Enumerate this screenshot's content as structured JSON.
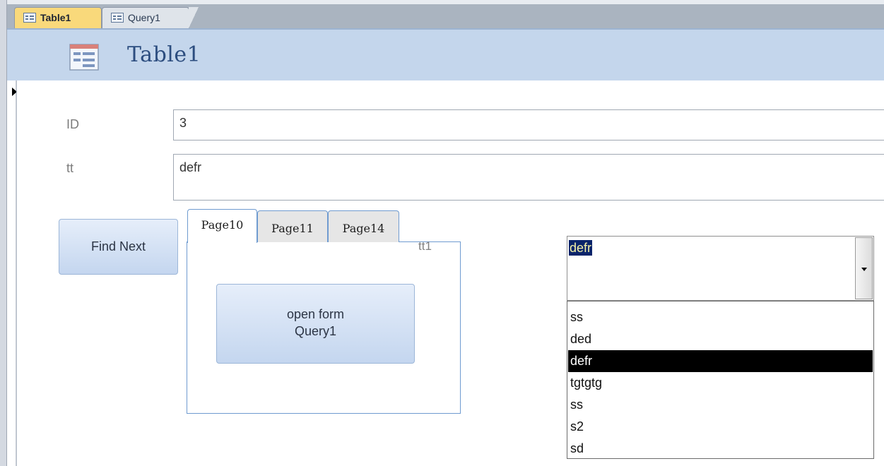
{
  "tabs": [
    {
      "label": "Table1"
    },
    {
      "label": "Query1"
    }
  ],
  "form": {
    "title": "Table1",
    "fields": {
      "id": {
        "label": "ID",
        "value": "3"
      },
      "tt": {
        "label": "tt",
        "value": "defr"
      }
    },
    "find_next_label": "Find Next",
    "tab_control": {
      "pages": [
        "Page10",
        "Page11",
        "Page14"
      ],
      "active_page": "Page10",
      "caption": "tt1",
      "open_form_line1": "open form",
      "open_form_line2": "Query1"
    },
    "combo": {
      "value": "defr",
      "options": [
        "ss",
        "ded",
        "defr",
        "tgtgtg",
        "ss",
        "s2",
        "sd"
      ],
      "selected_option": "defr"
    }
  },
  "colors": {
    "active_tab": "#f9d97b",
    "header_band": "#c4d6ec",
    "title_text": "#2c4d7f",
    "selection": "#000000"
  }
}
